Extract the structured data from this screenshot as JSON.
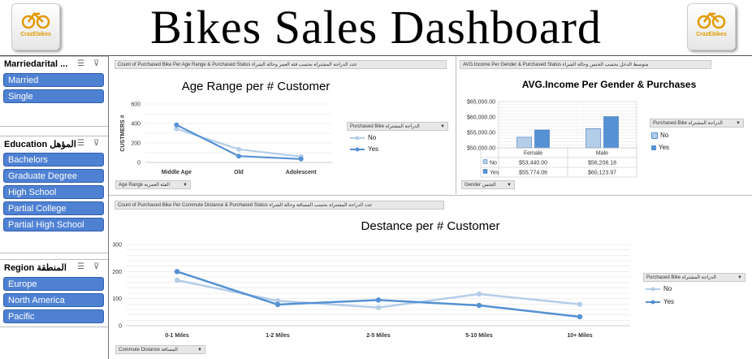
{
  "header": {
    "title": "Bikes Sales Dashboard",
    "logo_text": "CrazEbikes"
  },
  "slicers": {
    "marital": {
      "title": "Marriedarital ...",
      "items": [
        "Married",
        "Single"
      ]
    },
    "education": {
      "title": "Education المؤهل",
      "items": [
        "Bachelors",
        "Graduate Degree",
        "High School",
        "Partial College",
        "Partial High School"
      ]
    },
    "region": {
      "title": "Region المنطقة",
      "items": [
        "Europe",
        "North America",
        "Pacific"
      ]
    }
  },
  "age_chart": {
    "field_label": "Count of Purchased Bike Per Age Range & Purchased Status عدد الدراجة المشتراة بحسب فئة العمر وحالة الشراء",
    "title": "Age Range per # Customer",
    "legend_button": "Purchased Bike الدراجة المشتراة",
    "axis_button": "Age Range الفئة العمرية",
    "colors": {
      "No": "#b4cde8",
      "Yes": "#5591d3"
    }
  },
  "income_chart": {
    "field_label": "AVG.Income Per Gender & Purchased Status متوسط الدخل بحسب الجنس وحالة الشراء",
    "title": "AVG.Income Per Gender & Purchases",
    "legend_button": "Purchased Bike الدراجة المشتراة",
    "axis_button": "Gender الجنس",
    "table": {
      "columns": [
        "Female",
        "Male"
      ],
      "rows": [
        {
          "label": "No",
          "values": [
            "$53,440.00",
            "$56,208.18"
          ]
        },
        {
          "label": "Yes",
          "values": [
            "$55,774.06",
            "$60,123.97"
          ]
        }
      ]
    }
  },
  "distance_chart": {
    "field_label": "Count of Purchased Bike Per Commute Distance & Purchased Status عدد الدراجة المشتراة بحسب المسافة وحالة الشراء",
    "title": "Destance per # Customer",
    "legend_button": "Purchased Bike الدراجة المشتراة",
    "axis_button": "Commute Distance المسافة"
  },
  "chart_data": [
    {
      "type": "line",
      "title": "Age Range per # Customer",
      "xlabel": "",
      "ylabel": "CUSTMERS #",
      "categories": [
        "Middle Age",
        "Old",
        "Adolescent"
      ],
      "ylim": [
        0,
        600
      ],
      "yticks": [
        "0",
        "200",
        "400",
        "600"
      ],
      "series": [
        {
          "name": "No",
          "values": [
            345,
            135,
            60
          ]
        },
        {
          "name": "Yes",
          "values": [
            385,
            65,
            35
          ]
        }
      ],
      "legend": "right"
    },
    {
      "type": "bar",
      "title": "AVG.Income Per Gender & Purchases",
      "categories": [
        "Female",
        "Male"
      ],
      "ylim": [
        50000,
        65000
      ],
      "yticks": [
        "$50,000.00",
        "$55,000.00",
        "$60,000.00",
        "$65,000.00"
      ],
      "series": [
        {
          "name": "No",
          "values": [
            53440.0,
            56208.18
          ]
        },
        {
          "name": "Yes",
          "values": [
            55774.06,
            60123.97
          ]
        }
      ],
      "legend": "right"
    },
    {
      "type": "line",
      "title": "Destance per # Customer",
      "categories": [
        "0-1 Miles",
        "1-2 Miles",
        "2-5 Miles",
        "5-10 Miles",
        "10+ Miles"
      ],
      "ylim": [
        0,
        300
      ],
      "yticks": [
        "0",
        "100",
        "200",
        "300"
      ],
      "series": [
        {
          "name": "No",
          "values": [
            168,
            92,
            67,
            117,
            79
          ]
        },
        {
          "name": "Yes",
          "values": [
            200,
            78,
            95,
            75,
            33
          ]
        }
      ],
      "legend": "right"
    }
  ]
}
